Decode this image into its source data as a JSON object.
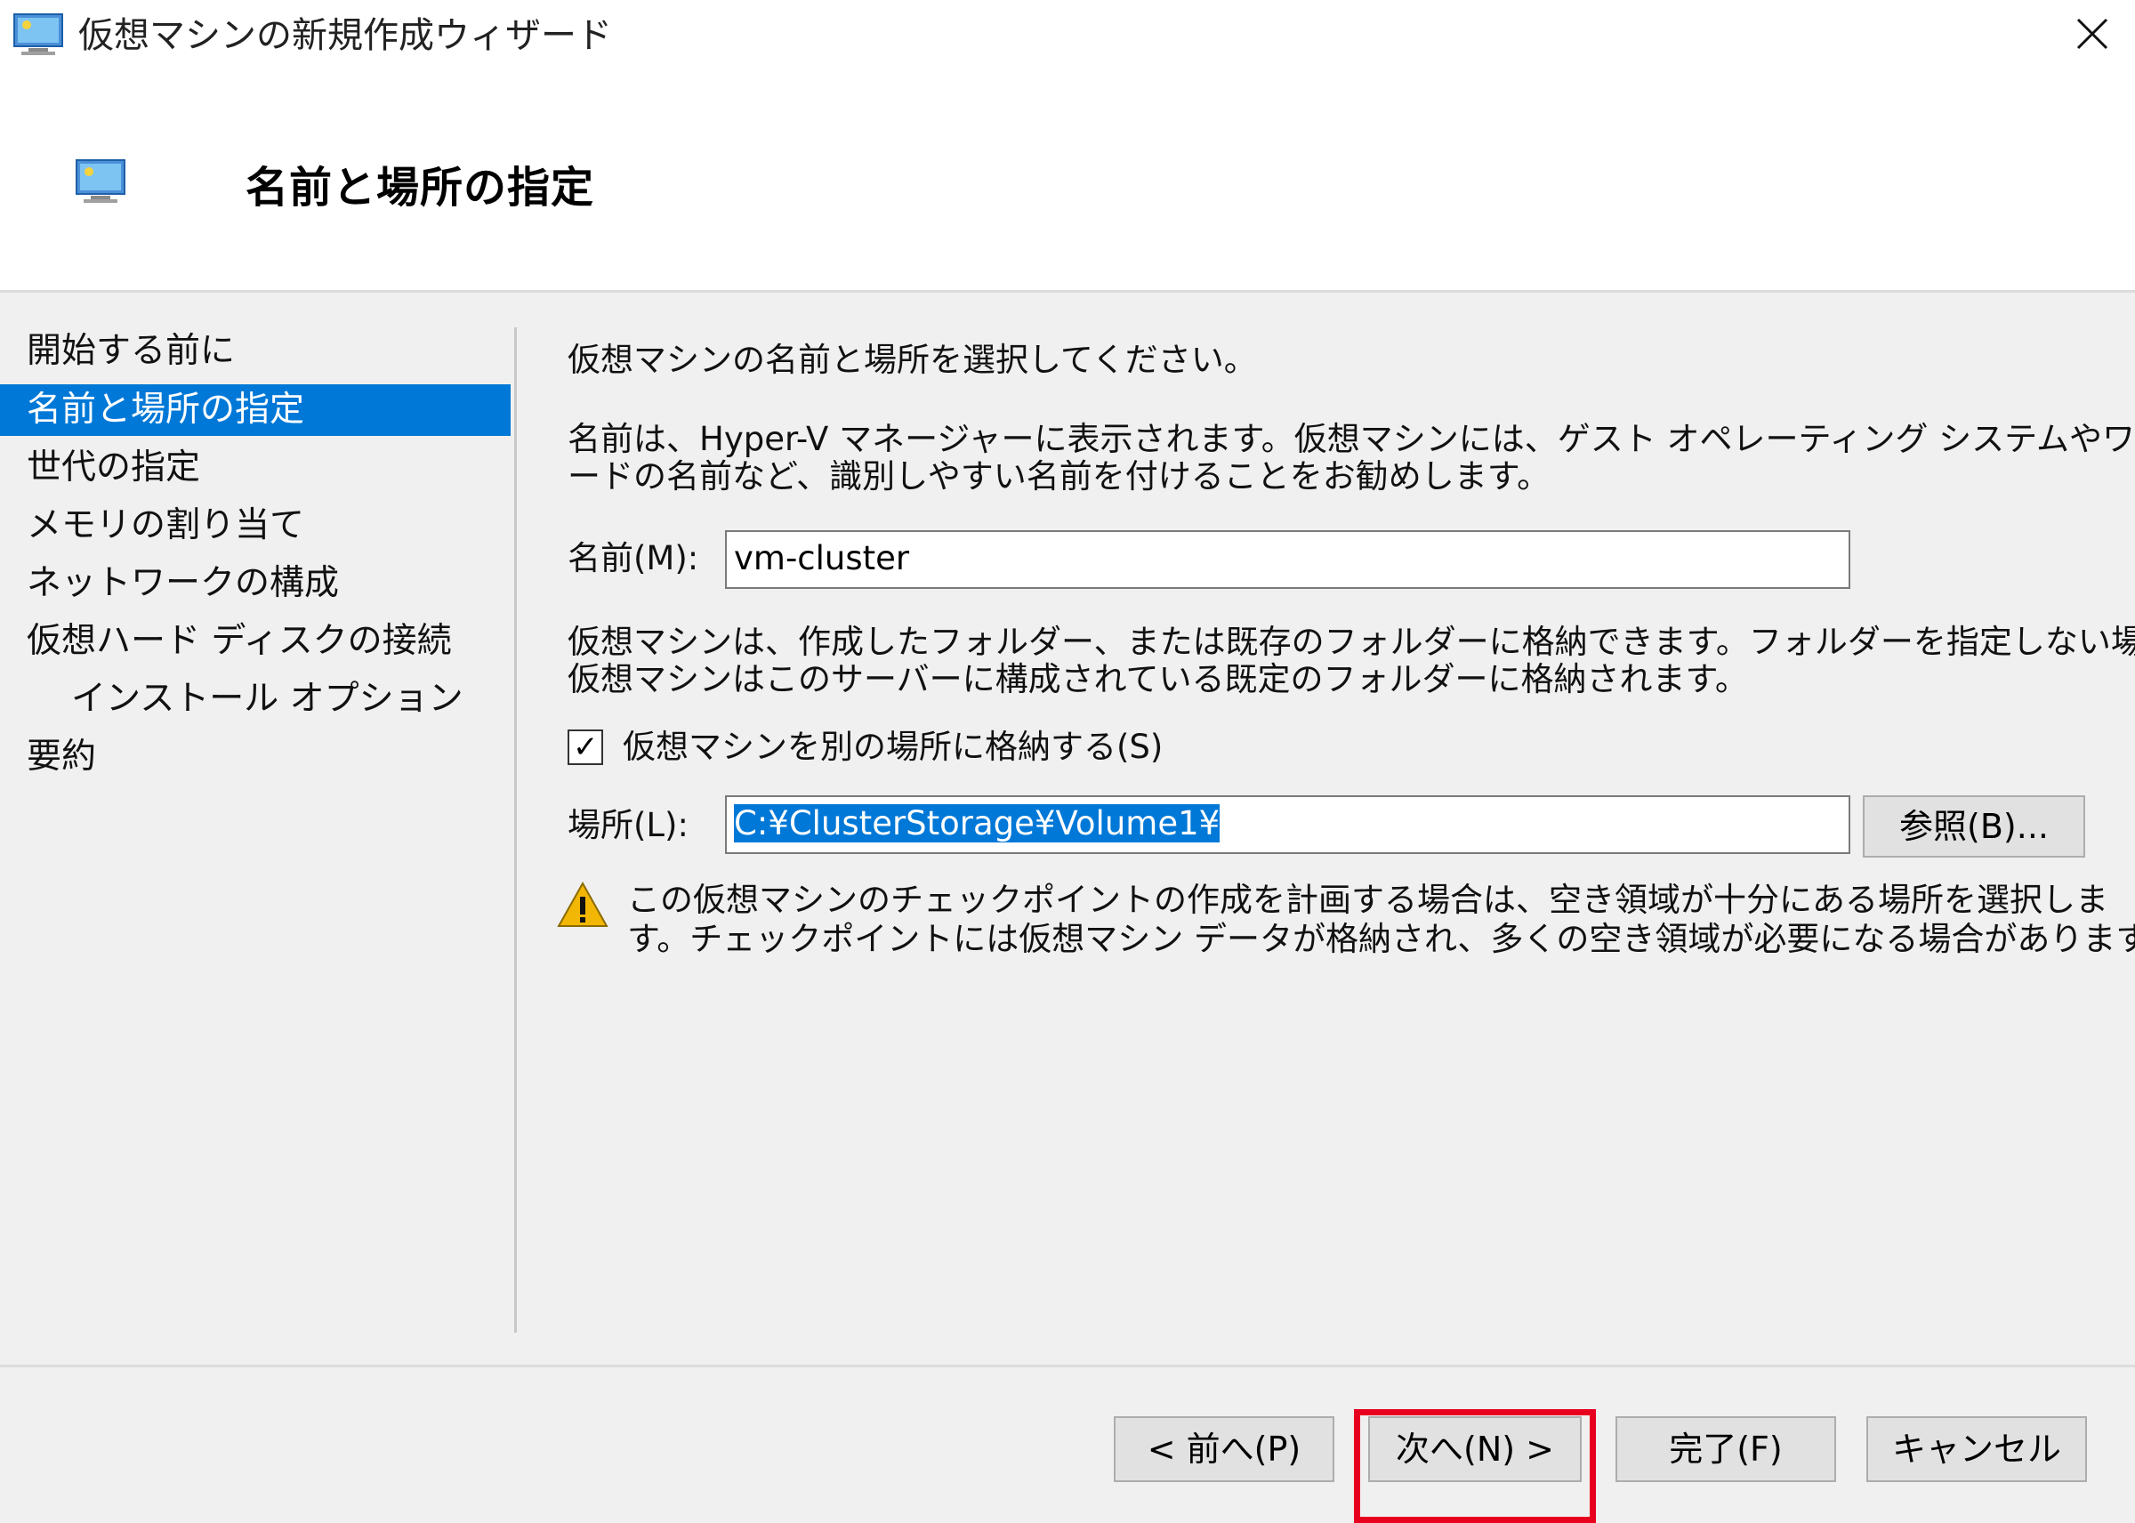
{
  "window": {
    "title": "仮想マシンの新規作成ウィザード",
    "close_glyph": "✕"
  },
  "header": {
    "heading": "名前と場所の指定"
  },
  "nav": {
    "items": [
      {
        "label": "開始する前に"
      },
      {
        "label": "名前と場所の指定",
        "active": true
      },
      {
        "label": "世代の指定"
      },
      {
        "label": "メモリの割り当て"
      },
      {
        "label": "ネットワークの構成"
      },
      {
        "label": "仮想ハード ディスクの接続"
      },
      {
        "label": "インストール オプション",
        "sub": true
      },
      {
        "label": "要約"
      }
    ]
  },
  "content": {
    "intro": "仮想マシンの名前と場所を選択してください。",
    "name_desc_line1": "名前は、Hyper-V マネージャーに表示されます。仮想マシンには、ゲスト オペレーティング システムやワークロ",
    "name_desc_line2": "ードの名前など、識別しやすい名前を付けることをお勧めします。",
    "name_label": "名前(M):",
    "name_value": "vm-cluster",
    "store_desc_line1": "仮想マシンは、作成したフォルダー、または既存のフォルダーに格納できます。フォルダーを指定しない場合、",
    "store_desc_line2": "仮想マシンはこのサーバーに構成されている既定のフォルダーに格納されます。",
    "checkbox_label": "仮想マシンを別の場所に格納する(S)",
    "checkbox_checked": true,
    "checkbox_glyph": "✓",
    "location_label": "場所(L):",
    "location_value": "C:¥ClusterStorage¥Volume1¥",
    "browse_label": "参照(B)...",
    "warning_line1": "この仮想マシンのチェックポイントの作成を計画する場合は、空き領域が十分にある場所を選択しま",
    "warning_line2": "す。チェックポイントには仮想マシン データが格納され、多くの空き領域が必要になる場合があります。"
  },
  "footer": {
    "prev_label": "< 前へ(P)",
    "next_label": "次へ(N) >",
    "finish_label": "完了(F)",
    "cancel_label": "キャンセル"
  },
  "colors": {
    "accent": "#0078d7",
    "highlight": "#e8001f",
    "warning": "#f2b705"
  }
}
